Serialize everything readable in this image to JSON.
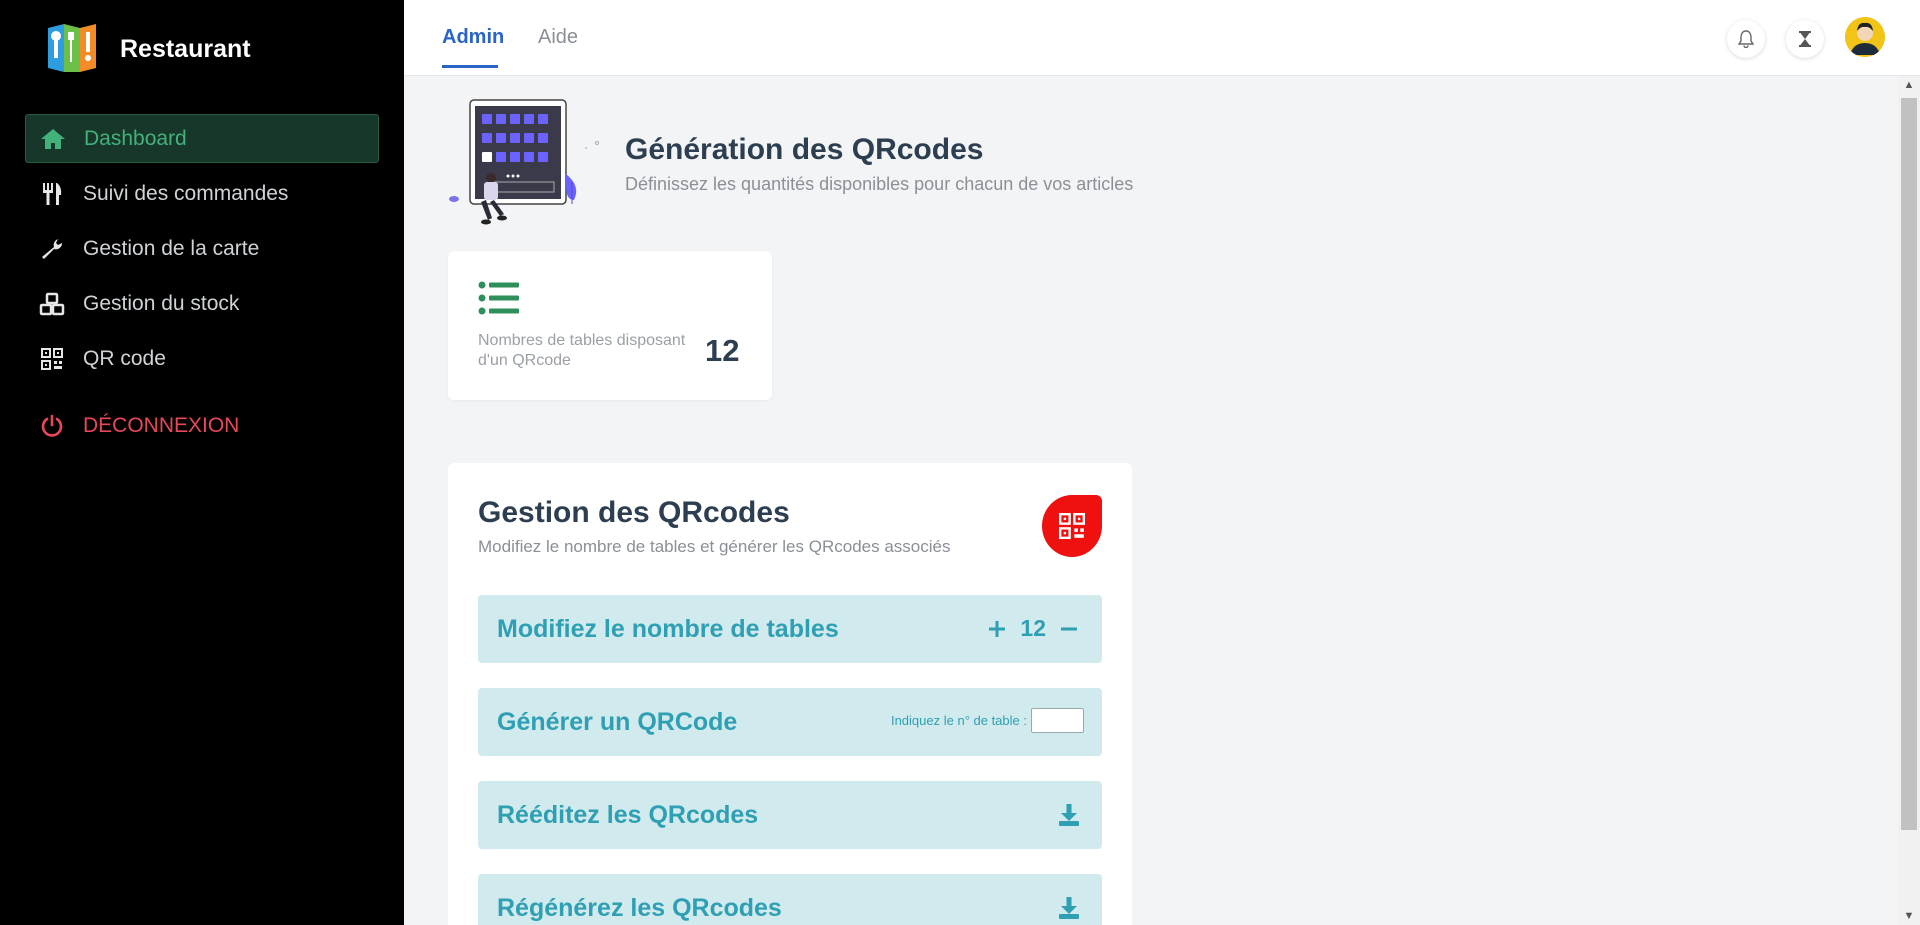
{
  "app": {
    "name": "Restaurant"
  },
  "sidebar": {
    "items": [
      {
        "label": "Dashboard",
        "icon": "home-icon",
        "active": true
      },
      {
        "label": "Suivi des commandes",
        "icon": "utensils-icon"
      },
      {
        "label": "Gestion de la carte",
        "icon": "wrench-icon"
      },
      {
        "label": "Gestion du stock",
        "icon": "cubes-icon"
      },
      {
        "label": "QR code",
        "icon": "qrcode-icon"
      }
    ],
    "logout": {
      "label": "DÉCONNEXION",
      "icon": "power-icon"
    }
  },
  "topbar": {
    "tabs": [
      {
        "label": "Admin",
        "active": true
      },
      {
        "label": "Aide"
      }
    ],
    "icons": [
      "bell-icon",
      "hourglass-icon",
      "avatar"
    ]
  },
  "header": {
    "title": "Génération des QRcodes",
    "subtitle": "Définissez les quantités disponibles pour chacun de vos articles"
  },
  "stat_card": {
    "label": "Nombres de tables disposant d'un QRcode",
    "value": "12"
  },
  "management": {
    "title": "Gestion des QRcodes",
    "subtitle": "Modifiez le nombre de tables et générer les QRcodes associés",
    "rows": [
      {
        "label": "Modifiez le nombre de tables",
        "value": "12"
      },
      {
        "label": "Générer un QRCode",
        "input_label": "Indiquez le n° de table :",
        "input_value": ""
      },
      {
        "label": "Rééditez les QRcodes"
      },
      {
        "label": "Régénérez les QRcodes"
      }
    ]
  },
  "colors": {
    "sidebar_bg": "#000000",
    "active_green": "#43b17a",
    "logout_red": "#e8475a",
    "accent_blue": "#2a64c9",
    "row_bg": "#d1eaee",
    "row_text": "#2f9fb3",
    "badge_red": "#ef1010"
  }
}
